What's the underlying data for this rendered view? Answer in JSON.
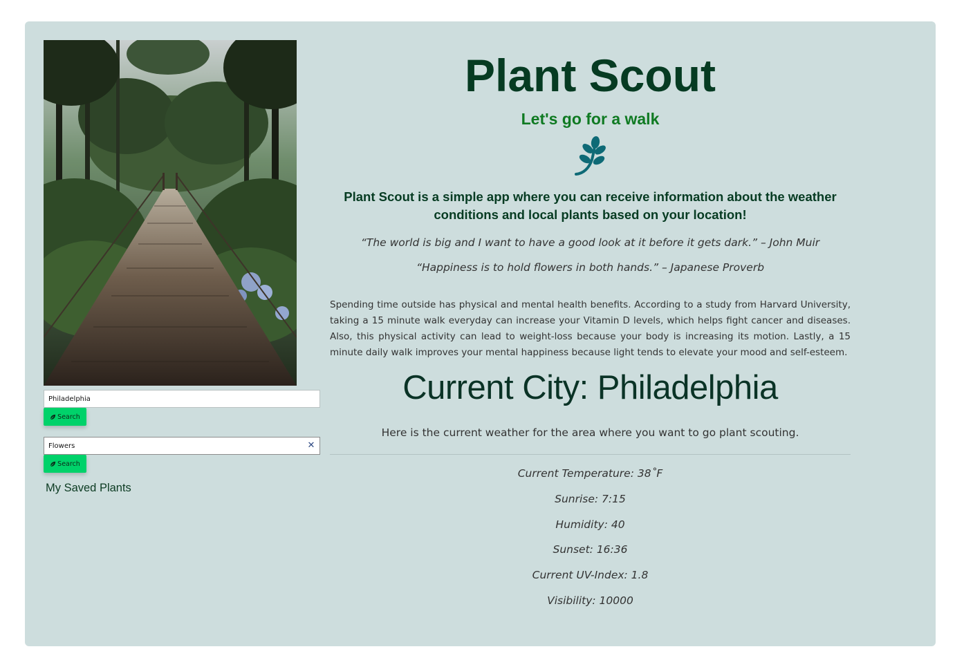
{
  "app": {
    "title": "Plant Scout",
    "subtitle": "Let's go for a walk",
    "icon": "seedling-icon",
    "colors": {
      "background": "#cddddd",
      "title": "#063b22",
      "subtitle": "#0f7a22",
      "icon": "#0e6a76",
      "button": "#00d26a"
    }
  },
  "sidebar": {
    "photo_icon": "forest-bridge-photo",
    "city_search": {
      "value": "Philadelphia",
      "button_label": "Search",
      "button_icon": "leaf-icon"
    },
    "plant_search": {
      "value": "Flowers",
      "clear_icon": "close-icon",
      "clear_glyph": "✕",
      "button_label": "Search",
      "button_icon": "leaf-icon"
    },
    "saved_title": "My Saved Plants"
  },
  "main": {
    "intro": "Plant Scout is a simple app where you can receive information about the weather conditions and local plants based on your location!",
    "quotes": [
      "“The world is big and I want to have a good look at it before it gets dark.” – John Muir",
      "“Happiness is to hold flowers in both hands.” – Japanese Proverb"
    ],
    "body": "Spending time outside has physical and mental health benefits. According to a study from Harvard University, taking a 15 minute walk everyday can increase your Vitamin D levels, which helps fight cancer and diseases. Also, this physical activity can lead to weight-loss because your body is increasing its motion. Lastly, a 15 minute daily walk improves your mental happiness because light tends to elevate your mood and self-esteem.",
    "city_heading": "Current City: Philadelphia",
    "weather_lead": "Here is the current weather for the area where you want to go plant scouting.",
    "weather": {
      "temperature": "Current Temperature: 38˚F",
      "sunrise": "Sunrise: 7:15",
      "humidity": "Humidity: 40",
      "sunset": "Sunset: 16:36",
      "uv_index": "Current UV-Index: 1.8",
      "visibility": "Visibility: 10000"
    }
  }
}
